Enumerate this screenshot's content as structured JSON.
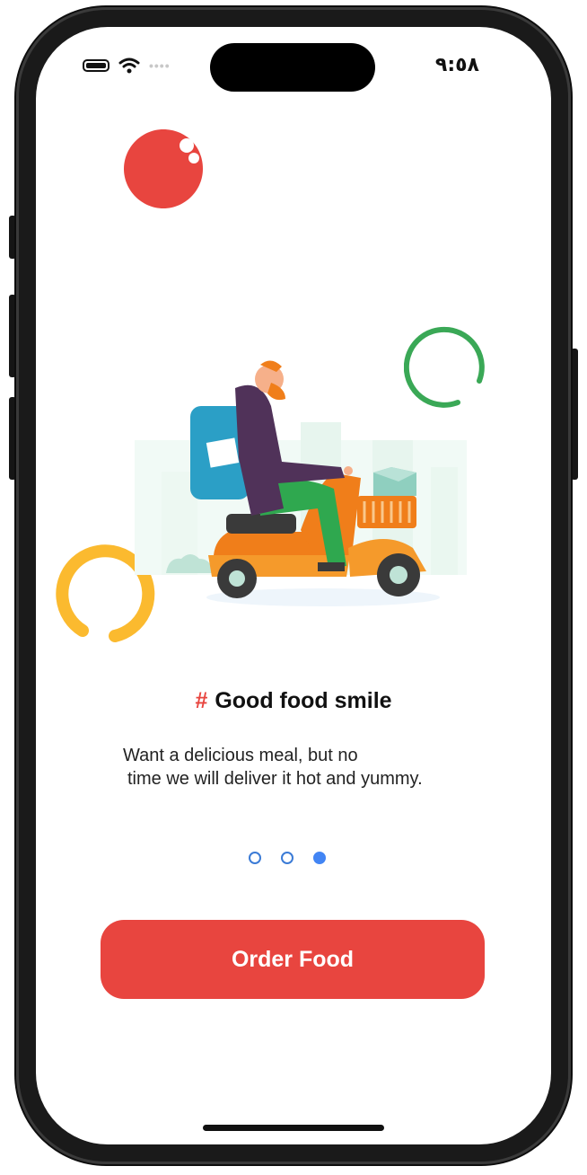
{
  "status_bar": {
    "time": "٩:٥٨",
    "signal_dots": "••••",
    "icons": [
      "battery-icon",
      "wifi-icon",
      "cellular-signal-icon"
    ]
  },
  "onboarding": {
    "illustration": "delivery-scooter-illustration",
    "title_hash": "#",
    "title": "Good food smile",
    "description_line1": "Want a delicious meal, but no",
    "description_line2": "time we will deliver it hot and yummy.",
    "page_indicator": {
      "total": 3,
      "active_index": 2
    },
    "primary_button_label": "Order Food"
  },
  "colors": {
    "accent_red": "#e8453f",
    "deco_green": "#3aa856",
    "deco_yellow": "#fbba2f",
    "indicator_blue": "#4285f4"
  }
}
